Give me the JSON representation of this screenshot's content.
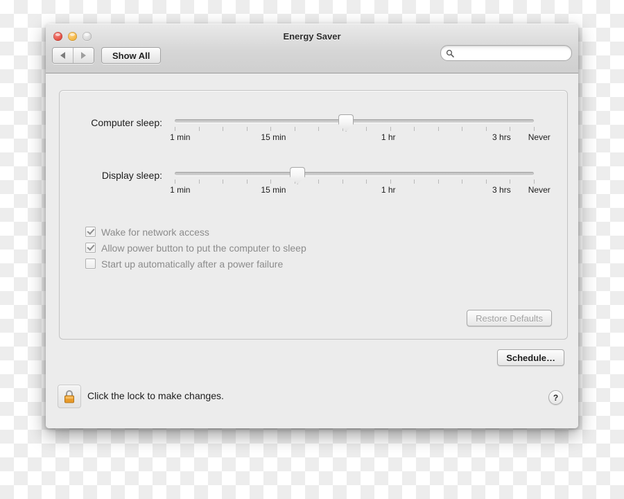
{
  "window": {
    "title": "Energy Saver",
    "traffic_lights": [
      {
        "name": "close",
        "color": "#e04a3f"
      },
      {
        "name": "minimize",
        "color": "#f2b33d"
      },
      {
        "name": "zoom",
        "color": "#d3d3d3"
      }
    ]
  },
  "toolbar": {
    "back_icon": "triangle-left-icon",
    "forward_icon": "triangle-right-icon",
    "show_all_label": "Show All",
    "search": {
      "icon": "search-icon",
      "value": "",
      "placeholder": ""
    }
  },
  "panel": {
    "sliders": [
      {
        "id": "computer-sleep",
        "label": "Computer sleep:",
        "value_percent": 47.5,
        "tick_count": 16,
        "scale_labels": [
          {
            "text": "1 min",
            "percent": 1.5
          },
          {
            "text": "15 min",
            "percent": 27.5
          },
          {
            "text": "1 hr",
            "percent": 59.5
          },
          {
            "text": "3 hrs",
            "percent": 91.0
          },
          {
            "text": "Never",
            "percent": 101.5
          }
        ]
      },
      {
        "id": "display-sleep",
        "label": "Display sleep:",
        "value_percent": 34.0,
        "tick_count": 16,
        "scale_labels": [
          {
            "text": "1 min",
            "percent": 1.5
          },
          {
            "text": "15 min",
            "percent": 27.5
          },
          {
            "text": "1 hr",
            "percent": 59.5
          },
          {
            "text": "3 hrs",
            "percent": 91.0
          },
          {
            "text": "Never",
            "percent": 101.5
          }
        ]
      }
    ],
    "checkboxes": [
      {
        "id": "wake-for-network-access",
        "label": "Wake for network access",
        "checked": true
      },
      {
        "id": "allow-power-button-sleep",
        "label": "Allow power button to put the computer to sleep",
        "checked": true
      },
      {
        "id": "start-up-after-power-failure",
        "label": "Start up automatically after a power failure",
        "checked": false
      }
    ],
    "restore_defaults_label": "Restore Defaults",
    "restore_defaults_enabled": false
  },
  "schedule_button_label": "Schedule…",
  "footer": {
    "lock_icon": "lock-closed-icon",
    "lock_text": "Click the lock to make changes.",
    "help_label": "?"
  }
}
